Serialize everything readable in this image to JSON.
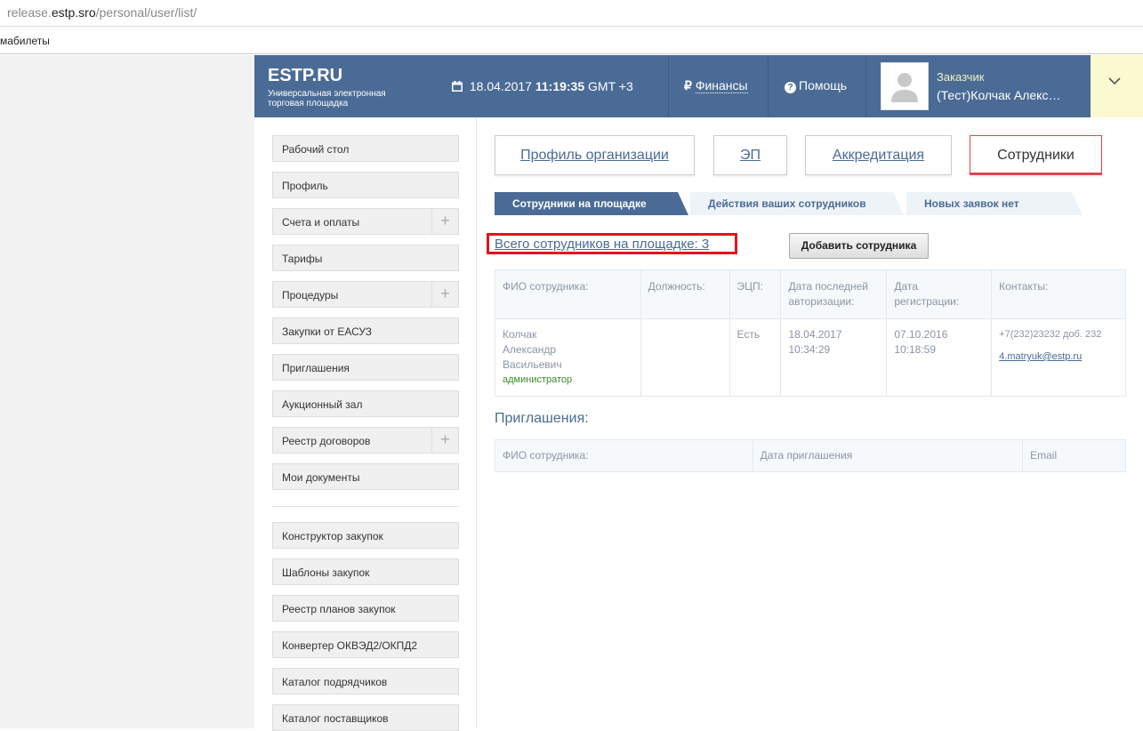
{
  "browser": {
    "url_host_prefix": "release.",
    "url_host": "estp.sro",
    "url_path": "/personal/user/list/",
    "bookmark": "мабилеты"
  },
  "header": {
    "logo_title": "ESTP.RU",
    "logo_subtitle": "Универсальная электронная торговая площадка",
    "date": "18.04.2017",
    "time": "11:19:35",
    "timezone": "GMT +3",
    "finance_symbol": "₽",
    "finance_label": "Финансы",
    "help_label": "Помощь",
    "user_role": "Заказчик",
    "user_name": "(Тест)Колчак Алекс…"
  },
  "sidebar": {
    "items": [
      {
        "label": "Рабочий стол"
      },
      {
        "label": "Профиль"
      },
      {
        "label": "Счета и оплаты"
      },
      {
        "label": "Тарифы"
      },
      {
        "label": "Процедуры"
      },
      {
        "label": "Закупки от ЕАСУЗ"
      },
      {
        "label": "Приглашения"
      },
      {
        "label": "Аукционный зал"
      },
      {
        "label": "Реестр договоров"
      },
      {
        "label": "Мои документы"
      },
      {
        "label": "Конструктор закупок"
      },
      {
        "label": "Шаблоны закупок"
      },
      {
        "label": "Реестр планов закупок"
      },
      {
        "label": "Конвертер ОКВЭД2/ОКПД2"
      },
      {
        "label": "Каталог подрядчиков"
      },
      {
        "label": "Каталог поставщиков"
      }
    ]
  },
  "main_tabs": [
    {
      "label": "Профиль организации",
      "active": false
    },
    {
      "label": "ЭП",
      "active": false
    },
    {
      "label": "Аккредитация",
      "active": false
    },
    {
      "label": "Сотрудники",
      "active": true
    }
  ],
  "sub_tabs": [
    {
      "label": "Сотрудники на площадке",
      "active": true
    },
    {
      "label": "Действия ваших сотрудников",
      "active": false
    },
    {
      "label": "Новых заявок нет",
      "active": false
    }
  ],
  "employees": {
    "count_text": "Всего сотрудников на площадке: 3",
    "add_button": "Добавить сотрудника",
    "columns": [
      "ФИО сотрудника:",
      "Должность:",
      "ЭЦП:",
      "Дата последней авторизации:",
      "Дата регистрации:",
      "Контакты:"
    ],
    "rows": [
      {
        "name_line1": "Колчак",
        "name_line2": "Александр",
        "name_line3": "Васильевич",
        "role": "администратор",
        "position": "",
        "signature": "Есть",
        "last_auth_date": "18.04.2017",
        "last_auth_time": "10:34:29",
        "reg_date": "07.10.2016",
        "reg_time": "10:18:59",
        "phone": "+7(232)23232 доб. 232",
        "email": "4.matryuk@estp.ru"
      }
    ]
  },
  "invitations": {
    "title": "Приглашения:",
    "columns": [
      "ФИО сотрудника:",
      "Дата приглашения",
      "Email"
    ]
  },
  "colors": {
    "header_bg": "#4a6b95",
    "accent_red": "#e0474c",
    "highlight_box": "#e0141e",
    "user_panel_bg": "#fbf9d0"
  }
}
